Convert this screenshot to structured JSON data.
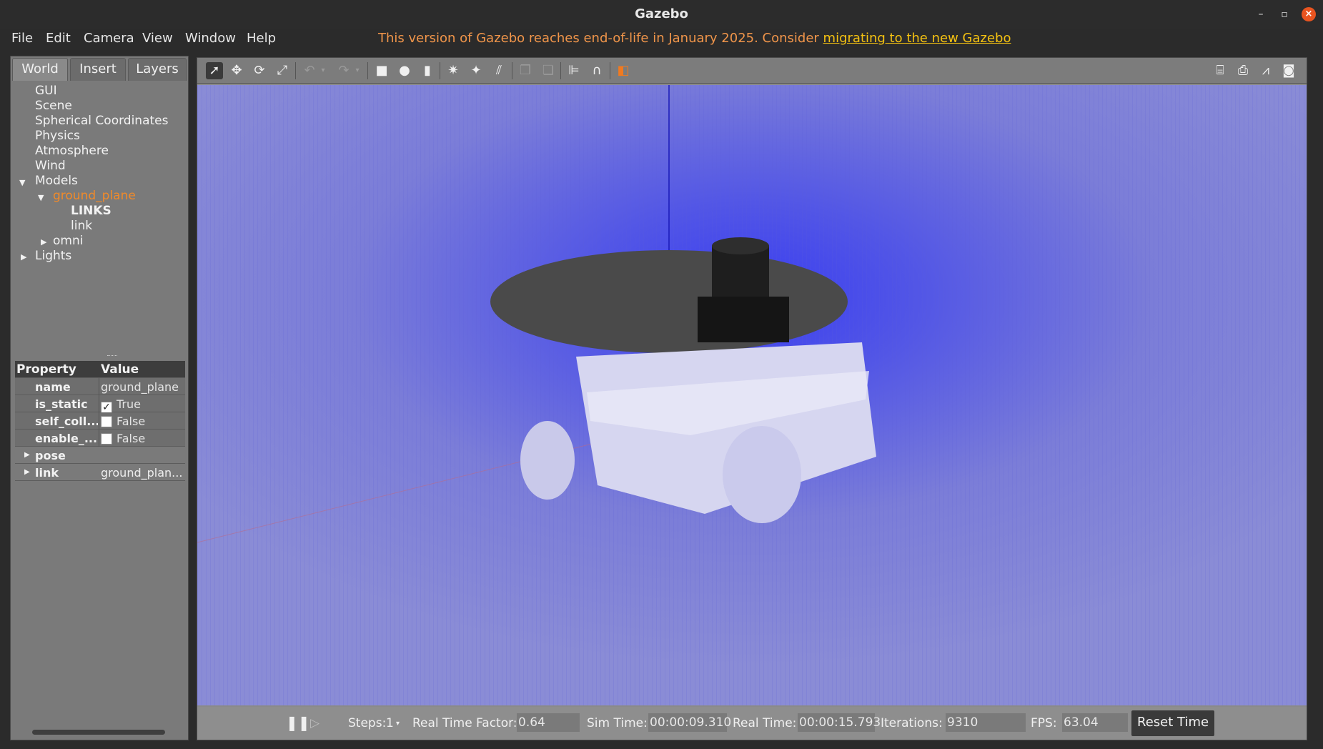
{
  "window": {
    "title": "Gazebo"
  },
  "menu": {
    "items": [
      "File",
      "Edit",
      "Camera",
      "View",
      "Window",
      "Help"
    ]
  },
  "notice": {
    "text": "This version of Gazebo reaches end-of-life in January 2025. Consider ",
    "link": "migrating to the new Gazebo"
  },
  "left_tabs": [
    "World",
    "Insert",
    "Layers"
  ],
  "tree": {
    "gui": "GUI",
    "scene": "Scene",
    "spherical": "Spherical Coordinates",
    "physics": "Physics",
    "atmosphere": "Atmosphere",
    "wind": "Wind",
    "models": "Models",
    "ground_plane": "ground_plane",
    "links_header": "LINKS",
    "link": "link",
    "omni": "omni",
    "lights": "Lights"
  },
  "properties": {
    "header": {
      "property": "Property",
      "value": "Value"
    },
    "rows": [
      {
        "name": "name",
        "value": "ground_plane"
      },
      {
        "name": "is_static",
        "value": "True",
        "checked": true
      },
      {
        "name": "self_coll...",
        "value": "False",
        "checked": false
      },
      {
        "name": "enable_...",
        "value": "False",
        "checked": false
      },
      {
        "name": "pose",
        "value": ""
      },
      {
        "name": "link",
        "value": "ground_plan..."
      }
    ]
  },
  "toolbar": {
    "icons": [
      "select-arrow-icon",
      "translate-icon",
      "rotate-icon",
      "scale-icon",
      "undo-icon",
      "redo-icon",
      "box-icon",
      "sphere-icon",
      "cylinder-icon",
      "point-light-icon",
      "spot-light-icon",
      "directional-light-icon",
      "copy-icon",
      "paste-icon",
      "align-icon",
      "snap-icon",
      "view-angle-icon",
      "screenshot-icon",
      "log-icon",
      "plot-icon",
      "video-icon"
    ]
  },
  "status": {
    "steps_label": "Steps:",
    "steps_value": "1",
    "rtf_label": "Real Time Factor:",
    "rtf_value": "0.64",
    "sim_label": "Sim Time:",
    "sim_value": "00:00:09.310",
    "real_label": "Real Time:",
    "real_value": "00:00:15.793",
    "iter_label": "Iterations:",
    "iter_value": "9310",
    "fps_label": "FPS:",
    "fps_value": "63.04",
    "reset_label": "Reset Time"
  },
  "colors": {
    "accent": "#e95420",
    "selected": "#f08a2a",
    "notice": "#f0954a",
    "notice_link": "#f5c211",
    "grid": "#4a4ee8"
  }
}
